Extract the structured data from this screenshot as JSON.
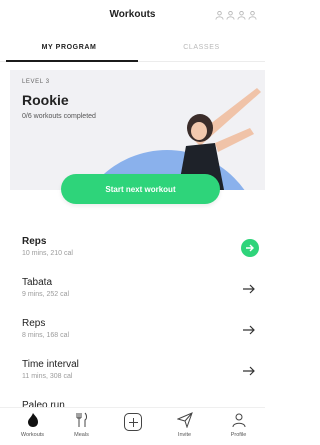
{
  "header": {
    "title": "Workouts",
    "avatar_icons": [
      "person-icon",
      "person-icon",
      "person-icon",
      "person-icon"
    ]
  },
  "tabs": [
    {
      "label": "MY PROGRAM",
      "active": true
    },
    {
      "label": "CLASSES",
      "active": false
    }
  ],
  "program": {
    "level": "LEVEL 3",
    "name": "Rookie",
    "progress": "0/6 workouts completed",
    "hero_image": "woman-stretching-illustration"
  },
  "start_button": {
    "label": "Start next workout"
  },
  "workouts": [
    {
      "name": "Reps",
      "meta": "10 mins, 210 cal",
      "highlighted": true
    },
    {
      "name": "Tabata",
      "meta": "9 mins, 252 cal",
      "highlighted": false
    },
    {
      "name": "Reps",
      "meta": "8 mins, 168 cal",
      "highlighted": false
    },
    {
      "name": "Time interval",
      "meta": "11 mins, 308 cal",
      "highlighted": false
    },
    {
      "name": "Paleo run",
      "meta": "",
      "highlighted": false
    }
  ],
  "nav": [
    {
      "label": "Workouts",
      "icon": "flame-icon"
    },
    {
      "label": "Meals",
      "icon": "fork-knife-icon"
    },
    {
      "label": "",
      "icon": "add-icon"
    },
    {
      "label": "Invite",
      "icon": "paper-plane-icon"
    },
    {
      "label": "Profile",
      "icon": "person-icon"
    }
  ],
  "colors": {
    "accent_green": "#2ed47a",
    "hero_background": "#f1f1f4",
    "hero_blue_shape": "#8ab1ec"
  }
}
